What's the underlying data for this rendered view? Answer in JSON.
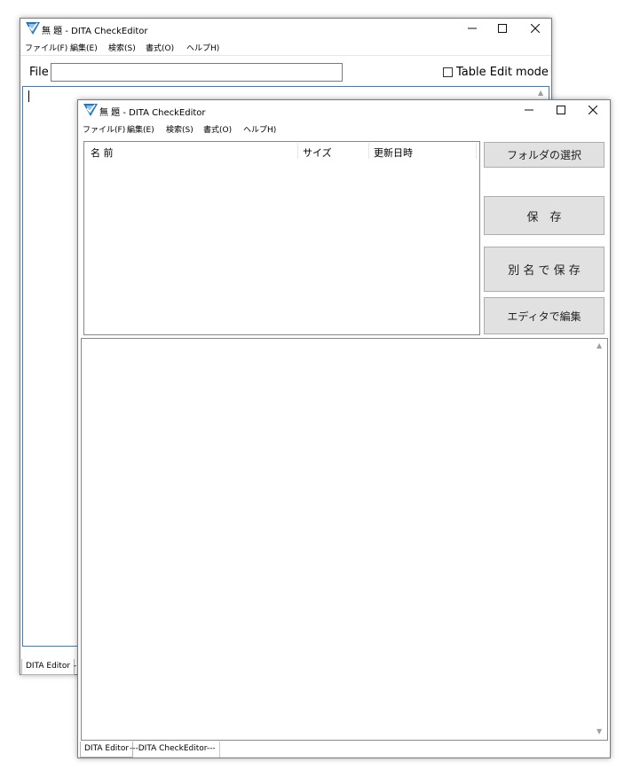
{
  "back_window": {
    "title": "無 題 - DITA CheckEditor",
    "menu": [
      "ファイル(F)",
      "編集(E)",
      "検索(S)",
      "書式(O)",
      "ヘルプH)"
    ],
    "file_label": "File",
    "file_value": "",
    "table_edit_label": "Table Edit mode",
    "table_edit_checked": false,
    "tab_active": "DITA Editor",
    "tab_second_fragment": "-"
  },
  "front_window": {
    "title": "無 題 - DITA CheckEditor",
    "menu": [
      "ファイル(F)",
      "編集(E)",
      "検索(S)",
      "書式(O)",
      "ヘルプH)"
    ],
    "columns": [
      "名 前",
      "サイズ",
      "更新日時"
    ],
    "buttons": {
      "select_folder": "フォルダの選択",
      "save": "保　存",
      "save_as": "別 名 で 保 存",
      "edit_in_editor": "エディタで編集"
    },
    "tabs": [
      "DITA Editor",
      "---DITA  CheckEditor---"
    ]
  },
  "colors": {
    "focus_border": "#2f7ed8",
    "button_face": "#e1e1e1",
    "icon_blue": "#1e74c7"
  }
}
